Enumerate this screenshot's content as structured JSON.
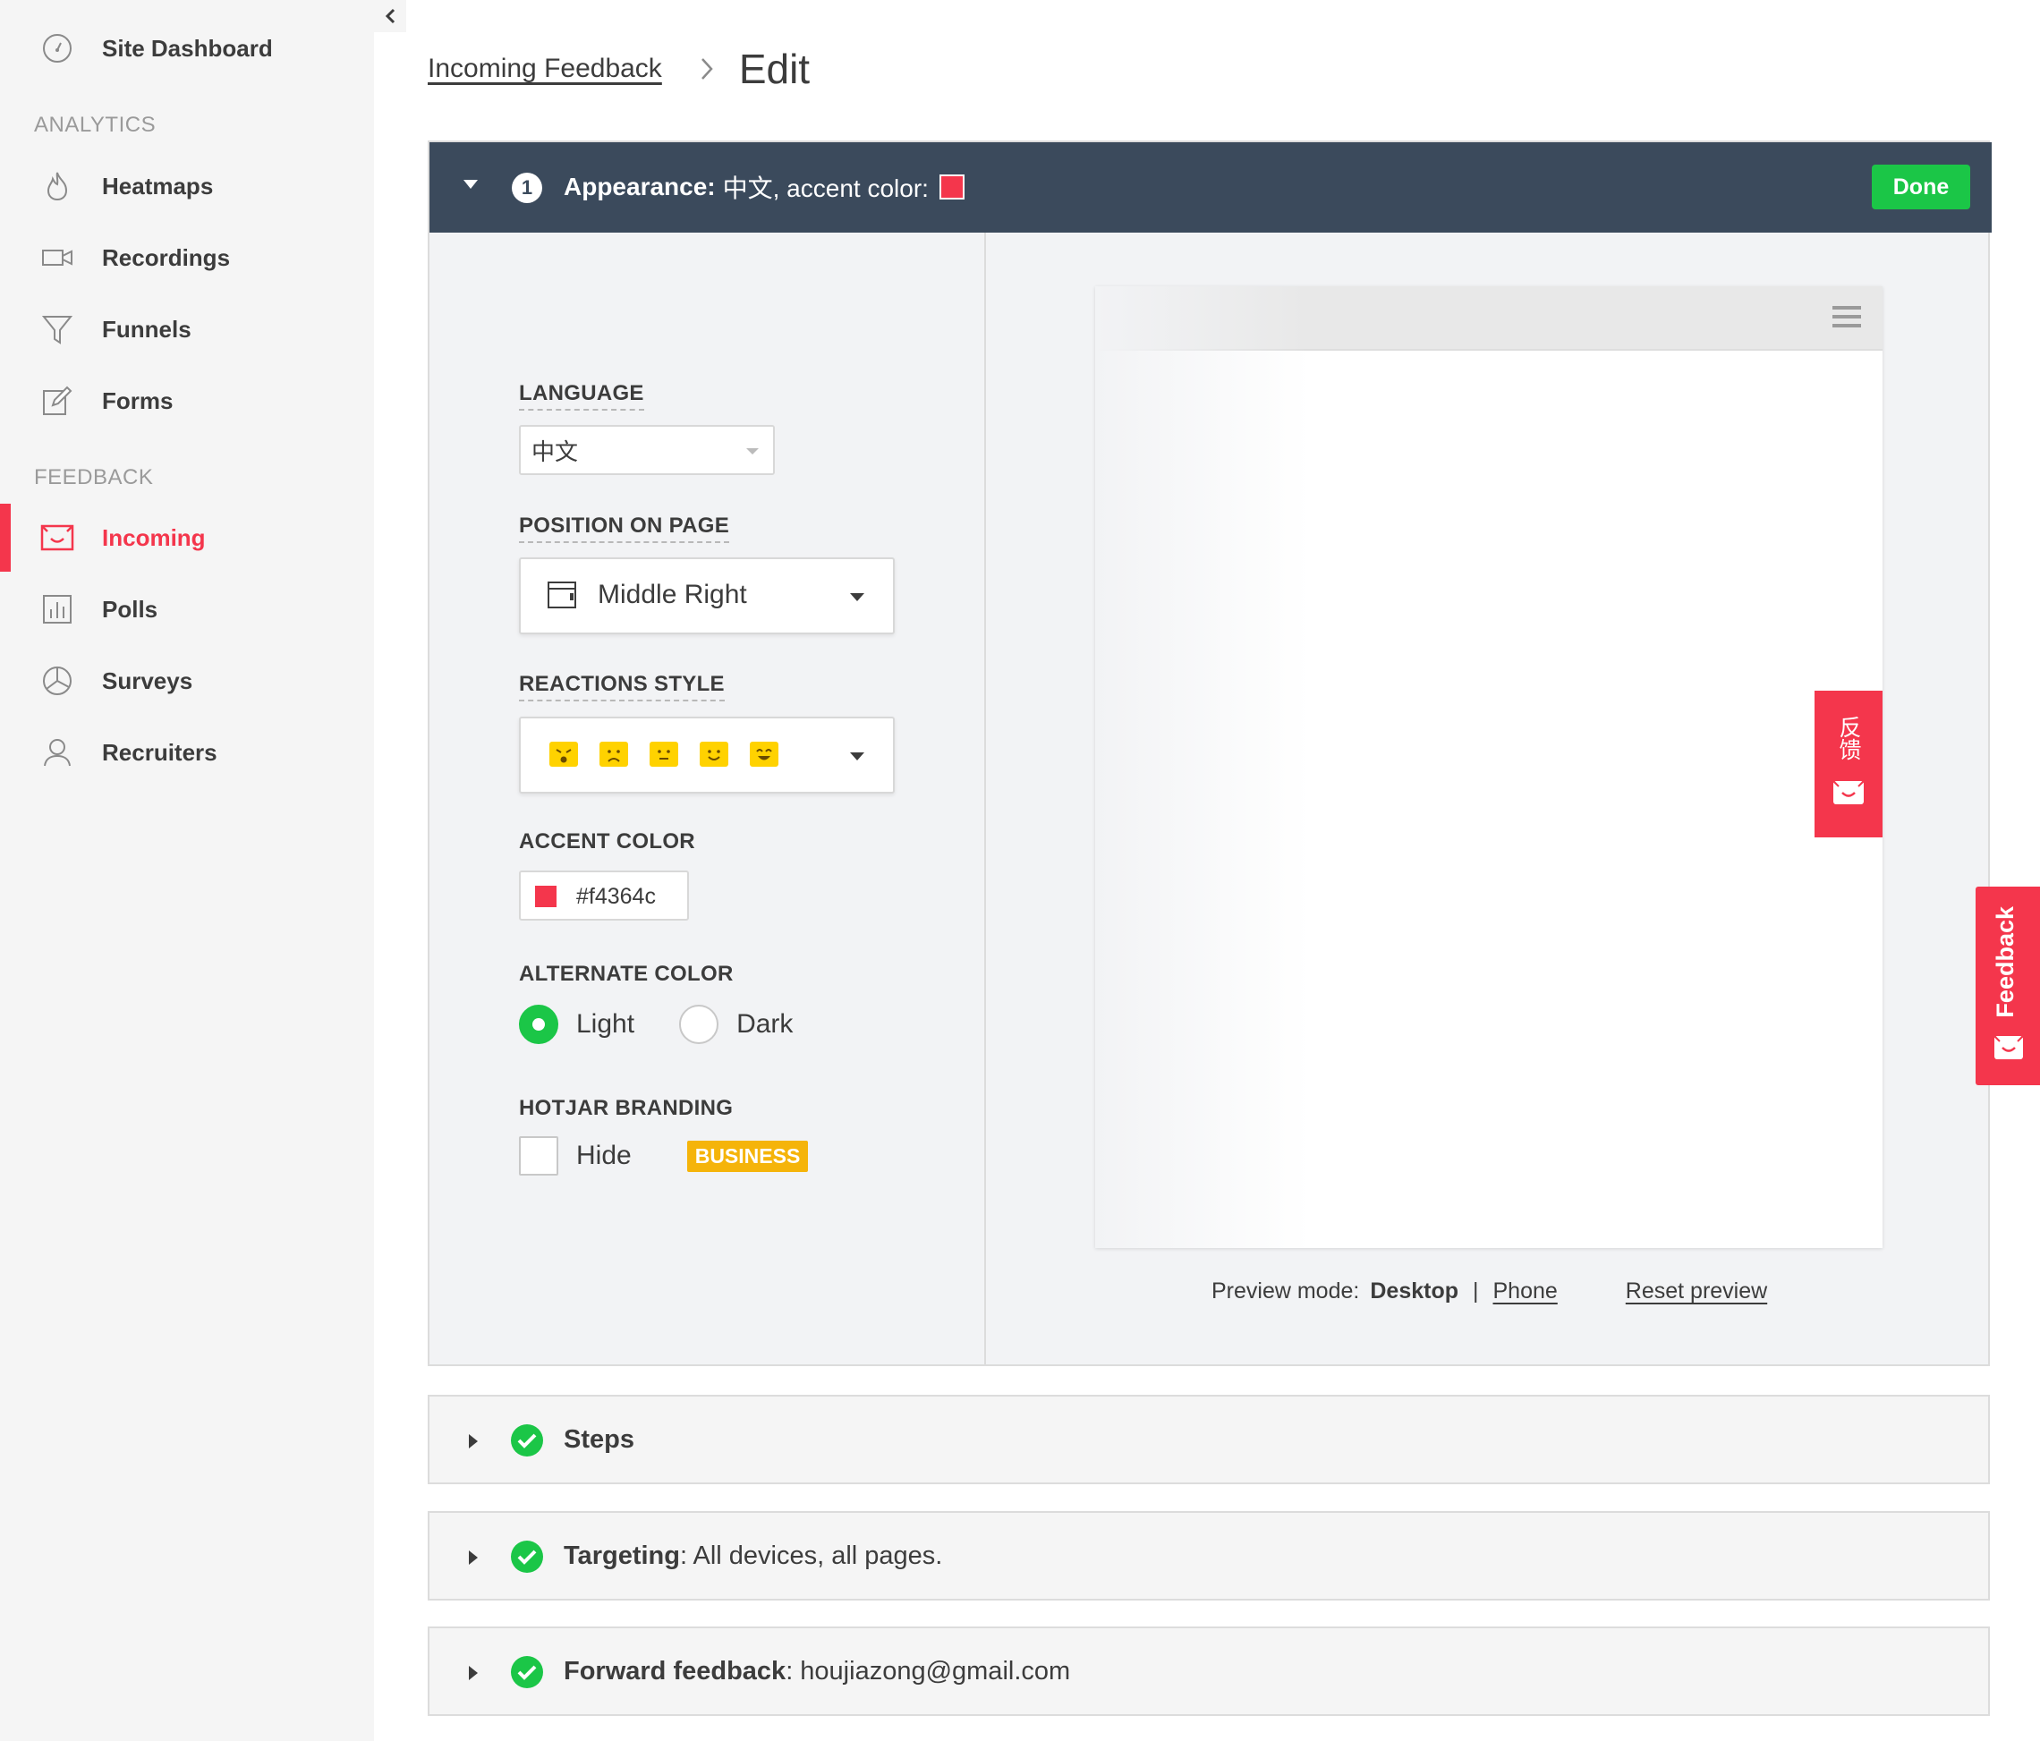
{
  "sidebar": {
    "dashboard_label": "Site Dashboard",
    "analytics_section": "ANALYTICS",
    "feedback_section": "FEEDBACK",
    "analytics_items": [
      {
        "label": "Heatmaps",
        "icon": "flame-icon"
      },
      {
        "label": "Recordings",
        "icon": "video-camera-icon"
      },
      {
        "label": "Funnels",
        "icon": "funnel-icon"
      },
      {
        "label": "Forms",
        "icon": "form-edit-icon"
      }
    ],
    "feedback_items": [
      {
        "label": "Incoming",
        "icon": "incoming-feedback-icon",
        "active": true
      },
      {
        "label": "Polls",
        "icon": "bar-chart-icon"
      },
      {
        "label": "Surveys",
        "icon": "pie-chart-icon"
      },
      {
        "label": "Recruiters",
        "icon": "user-icon"
      }
    ]
  },
  "breadcrumb": {
    "parent": "Incoming Feedback",
    "current": "Edit"
  },
  "appearance": {
    "step_number": "1",
    "title_bold": "Appearance:",
    "title_rest": "中文, accent color:",
    "done_label": "Done",
    "language_label": "LANGUAGE",
    "language_value": "中文",
    "position_label": "POSITION ON PAGE",
    "position_value": "Middle Right",
    "reactions_label": "REACTIONS STYLE",
    "accent_label": "ACCENT COLOR",
    "accent_value": "#f4364c",
    "alternate_label": "ALTERNATE COLOR",
    "alternate_options": [
      "Light",
      "Dark"
    ],
    "alternate_selected": "Light",
    "branding_label": "HOTJAR BRANDING",
    "branding_hide_label": "Hide",
    "branding_hide_checked": false,
    "business_badge": "BUSINESS"
  },
  "preview": {
    "widget_label": "反馈",
    "mode_label": "Preview mode:",
    "mode_current": "Desktop",
    "mode_alt": "Phone",
    "mode_separator": "|",
    "reset_label": "Reset preview"
  },
  "sections": {
    "steps": {
      "title": "Steps"
    },
    "targeting": {
      "title": "Targeting",
      "detail": ": All devices, all pages."
    },
    "forward": {
      "title": "Forward feedback",
      "detail": ": houjiazong@gmail.com"
    }
  },
  "feedback_tab": {
    "label": "Feedback"
  },
  "colors": {
    "accent": "#f4364c",
    "header": "#3b4a5c",
    "success": "#1bc647",
    "business": "#f5b40a",
    "reaction": "#ffd200"
  }
}
